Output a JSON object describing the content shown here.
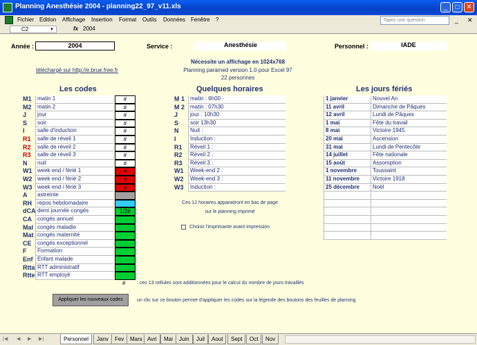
{
  "window": {
    "title": "Planning Anesthésie 2004 - planning22_97_v11.xls",
    "min": "_",
    "max": "□",
    "close": "✕"
  },
  "menu": {
    "items": [
      "Fichier",
      "Edition",
      "Affichage",
      "Insertion",
      "Format",
      "Outils",
      "Données",
      "Fenêtre",
      "?"
    ],
    "help_placeholder": "Tapez une question",
    "mdi_min": "_",
    "mdi_close": "✕"
  },
  "formula": {
    "cell": "C2",
    "fx": "fx",
    "value": "2004"
  },
  "header": {
    "annee_label": "Année :",
    "annee_value": "2004",
    "service_label": "Service :",
    "service_value": "Anesthésie",
    "personnel_label": "Personnel :",
    "personnel_value": "IADE"
  },
  "info": {
    "line1": "Nécessite un affichage en 1024x768",
    "line2": "Planning paramed version 1.0 pour Excel 97",
    "line3": "22 personnes",
    "link": "téléchargé sur http://e.brue.free.fr"
  },
  "codes": {
    "title": "Les codes",
    "rows": [
      {
        "code": "M1",
        "label": "matin 1",
        "box": "#",
        "color": "#ffffff",
        "code_color": "#1e2f70"
      },
      {
        "code": "M2",
        "label": "matin 2",
        "box": "#",
        "color": "#ffffff",
        "code_color": "#1e2f70"
      },
      {
        "code": "J",
        "label": "jour",
        "box": "#",
        "color": "#ffffff",
        "code_color": "#1e2f70"
      },
      {
        "code": "S",
        "label": "soir",
        "box": "#",
        "color": "#ffffff",
        "code_color": "#1e2f70"
      },
      {
        "code": "I",
        "label": "salle d'induction",
        "box": "#",
        "color": "#ffffff",
        "code_color": "#1e2f70"
      },
      {
        "code": "R1",
        "label": "salle de réveil 1",
        "box": "#",
        "color": "#ffffff",
        "code_color": "#c00000"
      },
      {
        "code": "R2",
        "label": "salle de réveil 2",
        "box": "#",
        "color": "#ffffff",
        "code_color": "#c00000"
      },
      {
        "code": "R3",
        "label": "salle de réveil 3",
        "box": "#",
        "color": "#ffffff",
        "code_color": "#c00000"
      },
      {
        "code": "N",
        "label": "nuit",
        "box": "#",
        "color": "#ffffff",
        "code_color": "#1e2f70"
      },
      {
        "code": "W1",
        "label": "week end / férié 1",
        "box": "#",
        "color": "#e00000",
        "code_color": "#1e2f70"
      },
      {
        "code": "W2",
        "label": "week end / férié 2",
        "box": "#",
        "color": "#e00000",
        "code_color": "#1e2f70"
      },
      {
        "code": "W3",
        "label": "week end / férié 3",
        "box": "#",
        "color": "#e00000",
        "code_color": "#1e2f70"
      },
      {
        "code": "A",
        "label": "astreinte",
        "box": "",
        "color": "#a0a0a0",
        "code_color": "#1e2f70"
      },
      {
        "code": "RH",
        "label": "repos hebdomadaire",
        "box": "",
        "color": "#33ccff",
        "code_color": "#1e2f70"
      },
      {
        "code": "dCA",
        "label": "demi journée congés",
        "box": "1/2#",
        "color": "#00cc33",
        "code_color": "#1e2f70"
      },
      {
        "code": "CA",
        "label": "congés annuel",
        "box": "",
        "color": "#00cc33",
        "code_color": "#1e2f70"
      },
      {
        "code": "Mal",
        "label": "congés maladie",
        "box": "",
        "color": "#00cc33",
        "code_color": "#1e2f70"
      },
      {
        "code": "Mat",
        "label": "congés maternité",
        "box": "",
        "color": "#00cc33",
        "code_color": "#1e2f70"
      },
      {
        "code": "CE",
        "label": "congés exceptionnel",
        "box": "",
        "color": "#00cc33",
        "code_color": "#1e2f70"
      },
      {
        "code": "F",
        "label": "Formation",
        "box": "",
        "color": "#00cc33",
        "code_color": "#1e2f70"
      },
      {
        "code": "Enf",
        "label": "Enfant malade",
        "box": "",
        "color": "#00cc33",
        "code_color": "#1e2f70"
      },
      {
        "code": "Rtta",
        "label": "RTT administratif",
        "box": "",
        "color": "#00cc33",
        "code_color": "#1e2f70"
      },
      {
        "code": "Rtte",
        "label": "RTT employé",
        "box": "",
        "color": "#00cc33",
        "code_color": "#1e2f70"
      }
    ],
    "footer_hash": "#",
    "footer_note": ": ces 13 cellules sont additionnées pour le calcul du nombre de jours travaillés"
  },
  "horaires": {
    "title": "Quelques horaires",
    "rows": [
      {
        "code": "M 1",
        "label": "matin : 6h00 -"
      },
      {
        "code": "M 2",
        "label": "matin : 07h30"
      },
      {
        "code": "J",
        "label": "jour : 10h30"
      },
      {
        "code": "S",
        "label": "soir 13h30"
      },
      {
        "code": "N",
        "label": "Nuit :"
      },
      {
        "code": "I",
        "label": "Induction :"
      },
      {
        "code": "R1",
        "label": "Réveil 1 :"
      },
      {
        "code": "R2",
        "label": "Réveil 2 :"
      },
      {
        "code": "R3",
        "label": "Réveil 3 :"
      },
      {
        "code": "W1",
        "label": "Week-end 2 :"
      },
      {
        "code": "W2",
        "label": "Week-end 3 :"
      },
      {
        "code": "W3",
        "label": "Induction :"
      }
    ],
    "note1": "Ces 12 horaires apparaitront en bas de page",
    "note2": "sur le planning imprimé",
    "checkbox_label": "Choisir l'imprimante avant impression"
  },
  "feries": {
    "title": "Les jours fériés",
    "rows": [
      {
        "date": "1 janvier",
        "name": "Nouvel An"
      },
      {
        "date": "11 avril",
        "name": "Dimanche de Pâques"
      },
      {
        "date": "12 avril",
        "name": "Lundi de Pâques"
      },
      {
        "date": "1 mai",
        "name": "Fête du travail"
      },
      {
        "date": "8 mai",
        "name": "Victoire 1945"
      },
      {
        "date": "20 mai",
        "name": "Ascension"
      },
      {
        "date": "31 mai",
        "name": "Lundi de Pentecôte"
      },
      {
        "date": "14 juillet",
        "name": "Fête nationale"
      },
      {
        "date": "15 août",
        "name": "Assomption"
      },
      {
        "date": "1 novembre",
        "name": "Toussaint"
      },
      {
        "date": "11 novembre",
        "name": "Victoire 1918"
      },
      {
        "date": "25 décembre",
        "name": "Noël"
      },
      {
        "date": "",
        "name": ""
      },
      {
        "date": "",
        "name": ""
      },
      {
        "date": "",
        "name": ""
      },
      {
        "date": "",
        "name": ""
      },
      {
        "date": "",
        "name": ""
      },
      {
        "date": "",
        "name": ""
      }
    ]
  },
  "apply": {
    "button": "Appliquer les nouveaux codes",
    "note": "un clic sur ce bouton permet d'appliquer les codes sur la légende des boutons des feuilles de planning"
  },
  "tabs": {
    "nav": [
      "|◀",
      "◀",
      "▶",
      "▶|"
    ],
    "sheets": [
      "Personnel",
      "Janv",
      "Fev",
      "Mars",
      "Avri",
      "Mai",
      "Juin",
      "Juil",
      "Aout",
      "Sept",
      "Oct",
      "Nov"
    ],
    "active": 0
  }
}
